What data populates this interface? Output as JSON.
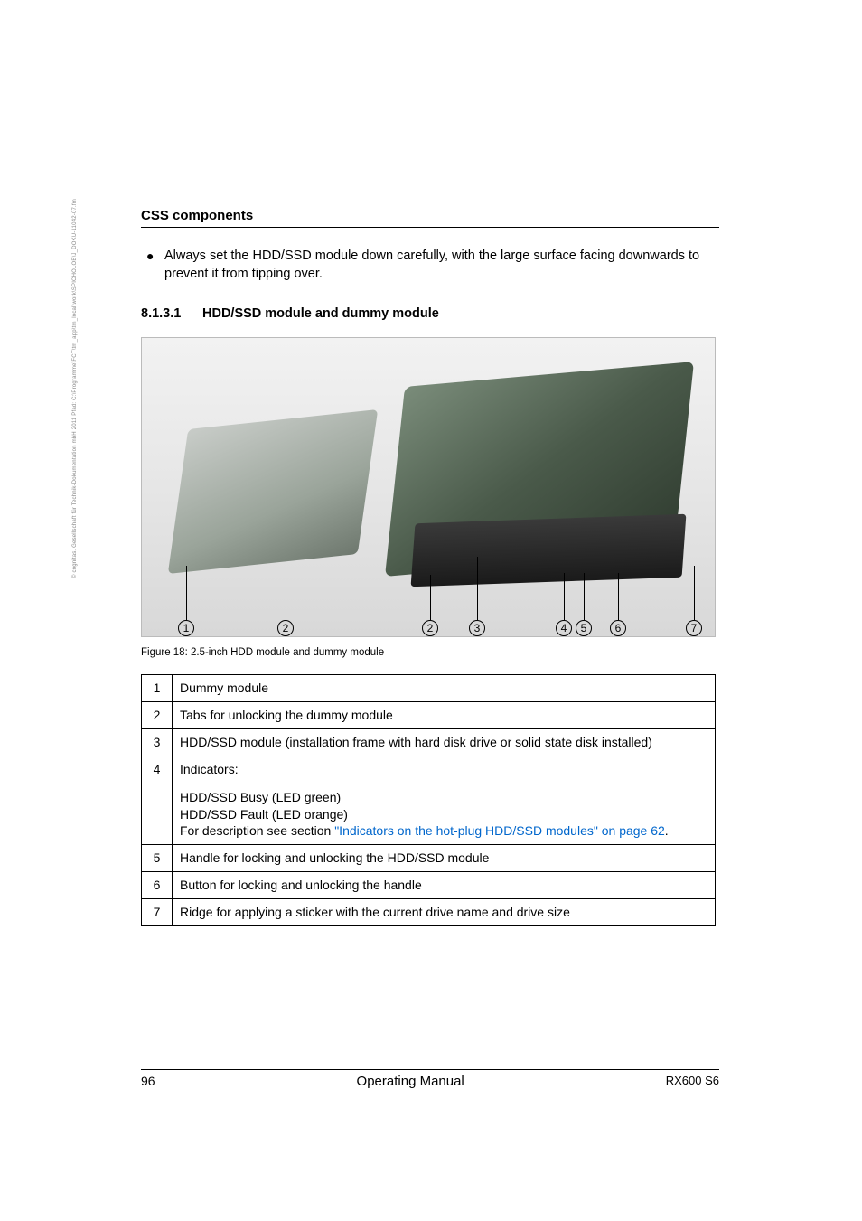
{
  "sideNote": "© cognitas. Gesellschaft für Technik-Dokumentation mbH 2011     Pfad: C:\\Programme\\FCT\\tm_app\\tm_local\\work\\SPICHOLOB\\J_DOKU-11042-07.fm",
  "headerTitle": "CSS components",
  "bullet": "Always set the HDD/SSD module down carefully, with the large surface facing downwards to prevent it from tipping over.",
  "subNumber": "8.1.3.1",
  "subTitle": "HDD/SSD module and dummy module",
  "callouts": [
    "1",
    "2",
    "2",
    "3",
    "4",
    "5",
    "6",
    "7"
  ],
  "figCaption": "Figure 18:  2.5-inch HDD module and dummy module",
  "rows": [
    {
      "n": "1",
      "t": "Dummy module"
    },
    {
      "n": "2",
      "t": "Tabs for unlocking the dummy module"
    },
    {
      "n": "3",
      "t": "HDD/SSD module (installation frame with hard disk drive or solid state disk installed)"
    },
    {
      "n": "4",
      "t": "Indicators:",
      "extra": {
        "l1": "HDD/SSD Busy (LED green)",
        "l2": "HDD/SSD Fault (LED orange)",
        "l3a": "For description see section ",
        "l3link": "\"Indicators on the hot-plug HDD/SSD modules\" on page 62",
        "l3b": "."
      }
    },
    {
      "n": "5",
      "t": "Handle for locking and unlocking the HDD/SSD module"
    },
    {
      "n": "6",
      "t": "Button for locking and unlocking the handle"
    },
    {
      "n": "7",
      "t": "Ridge for applying a sticker with the current drive name and drive size"
    }
  ],
  "footer": {
    "page": "96",
    "center": "Operating Manual",
    "right": "RX600 S6"
  }
}
